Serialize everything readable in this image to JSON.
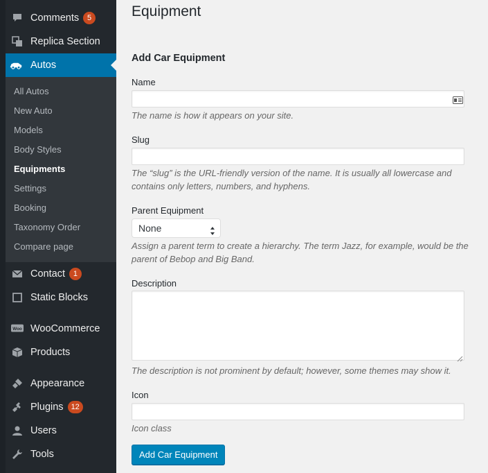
{
  "sidebar": {
    "top_items": [
      {
        "label": "Comments",
        "badge": "5",
        "icon": "comment-icon"
      },
      {
        "label": "Replica Section",
        "icon": "copy-icon"
      },
      {
        "label": "Autos",
        "icon": "car-icon"
      }
    ],
    "submenu": [
      {
        "label": "All Autos"
      },
      {
        "label": "New Auto"
      },
      {
        "label": "Models"
      },
      {
        "label": "Body Styles"
      },
      {
        "label": "Equipments"
      },
      {
        "label": "Settings"
      },
      {
        "label": "Booking"
      },
      {
        "label": "Taxonomy Order"
      },
      {
        "label": "Compare page"
      }
    ],
    "bottom_items": [
      {
        "label": "Contact",
        "badge": "1",
        "icon": "mail-icon"
      },
      {
        "label": "Static Blocks",
        "icon": "square-icon"
      },
      {
        "label": "WooCommerce",
        "icon": "woo-icon"
      },
      {
        "label": "Products",
        "icon": "box-icon"
      },
      {
        "label": "Appearance",
        "icon": "brush-icon"
      },
      {
        "label": "Plugins",
        "badge": "12",
        "icon": "plugin-icon"
      },
      {
        "label": "Users",
        "icon": "user-icon"
      },
      {
        "label": "Tools",
        "icon": "wrench-icon"
      }
    ],
    "active_color": "#0073aa"
  },
  "main": {
    "page_title": "Equipment",
    "form": {
      "heading": "Add Car Equipment",
      "name": {
        "label": "Name",
        "value": "",
        "help": "The name is how it appears on your site."
      },
      "slug": {
        "label": "Slug",
        "value": "",
        "help": "The “slug” is the URL-friendly version of the name. It is usually all lowercase and contains only letters, numbers, and hyphens."
      },
      "parent": {
        "label": "Parent Equipment",
        "selected": "None",
        "help": "Assign a parent term to create a hierarchy. The term Jazz, for example, would be the parent of Bebop and Big Band."
      },
      "description": {
        "label": "Description",
        "value": "",
        "help": "The description is not prominent by default; however, some themes may show it."
      },
      "icon": {
        "label": "Icon",
        "value": "",
        "help": "Icon class"
      },
      "submit_label": "Add Car Equipment"
    }
  }
}
